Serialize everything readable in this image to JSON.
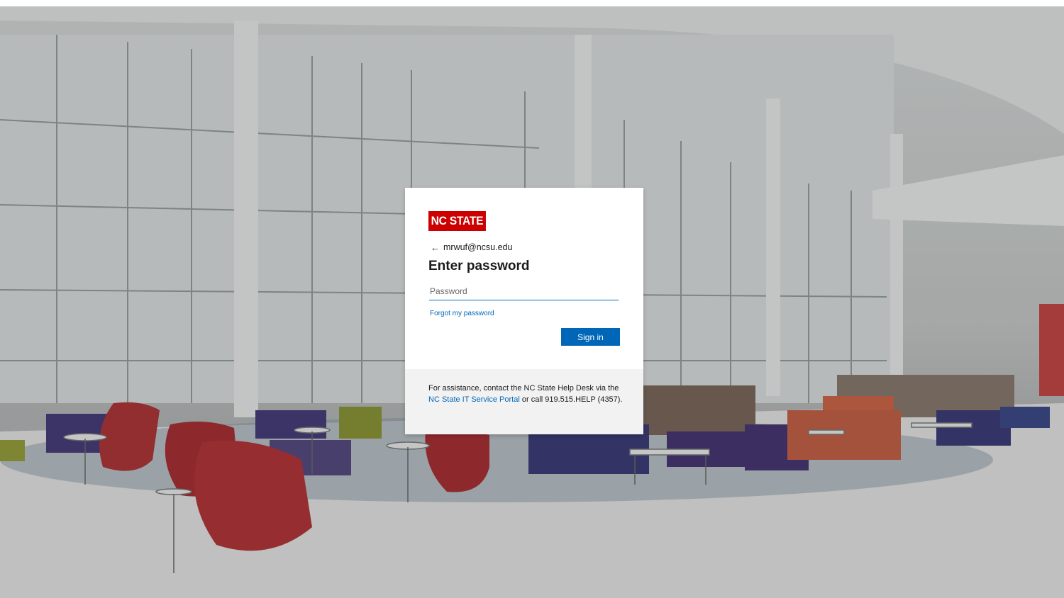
{
  "brand": {
    "logo_text": "NC STATE",
    "logo_color": "#cc0000"
  },
  "identity": {
    "back_icon": "arrow-left-icon",
    "email": "mrwuf@ncsu.edu"
  },
  "form": {
    "title": "Enter password",
    "password_placeholder": "Password",
    "password_value": "",
    "forgot_link": "Forgot my password",
    "signin_label": "Sign in"
  },
  "footer": {
    "assist_prefix": "For assistance, contact the NC State Help Desk via the ",
    "portal_link": "NC State IT Service Portal",
    "assist_suffix": " or call 919.515.HELP (4357)."
  },
  "colors": {
    "accent": "#0067b8",
    "footer_bg": "#f2f2f2"
  }
}
